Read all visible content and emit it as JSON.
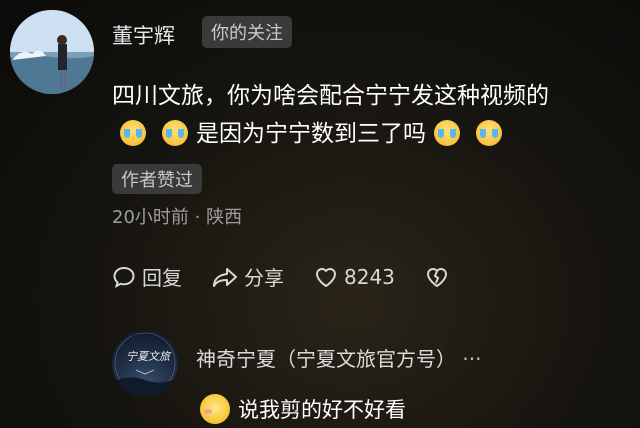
{
  "comment": {
    "username": "董宇辉",
    "follow_tag": "你的关注",
    "text_line1": "四川文旅，你为啥会配合宁宁发这种视频的",
    "text_line2": "是因为宁宁数到三了吗",
    "emoji_icon": "crying-laughing-emoji-icon",
    "author_tag": "作者赞过",
    "time_location": "20小时前 · 陕西",
    "actions": {
      "reply_label": "回复",
      "share_label": "分享",
      "like_count": "8243"
    }
  },
  "reply": {
    "username": "神奇宁夏（宁夏文旅官方号）",
    "more_label": "···",
    "text": "说我剪的好不好看",
    "emoji_icon": "shy-emoji-icon",
    "avatar_text": "宁夏文旅"
  }
}
